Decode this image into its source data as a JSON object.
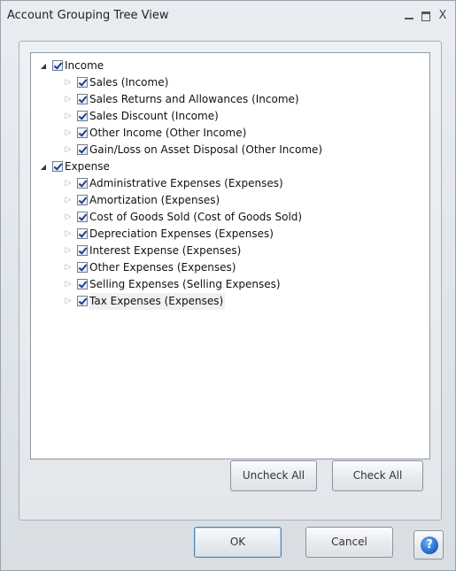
{
  "window": {
    "title": "Account Grouping Tree View",
    "close_glyph": "X"
  },
  "tree": {
    "income": {
      "label": "Income",
      "children": [
        "Sales (Income)",
        "Sales Returns and Allowances (Income)",
        "Sales Discount (Income)",
        "Other Income (Other Income)",
        "Gain/Loss on Asset Disposal (Other Income)"
      ]
    },
    "expense": {
      "label": "Expense",
      "children": [
        "Administrative Expenses (Expenses)",
        "Amortization (Expenses)",
        "Cost of Goods Sold (Cost of Goods Sold)",
        "Depreciation Expenses (Expenses)",
        "Interest Expense (Expenses)",
        "Other Expenses (Expenses)",
        "Selling Expenses (Selling Expenses)",
        "Tax Expenses (Expenses)"
      ]
    }
  },
  "buttons": {
    "uncheck_all": "Uncheck All",
    "check_all": "Check All",
    "ok": "OK",
    "cancel": "Cancel",
    "help": "?"
  },
  "icons": {
    "minimize": "minimize-icon",
    "maximize": "maximize-icon",
    "close": "close-icon",
    "expanded": "triangle-expanded-icon",
    "collapsed": "triangle-collapsed-icon",
    "checkbox": "checkbox-checked-icon",
    "help": "help-icon"
  },
  "colors": {
    "check_mark": "#1e3c9a",
    "help_blue": "#1c62c4",
    "ok_border": "#4a7fb5"
  }
}
